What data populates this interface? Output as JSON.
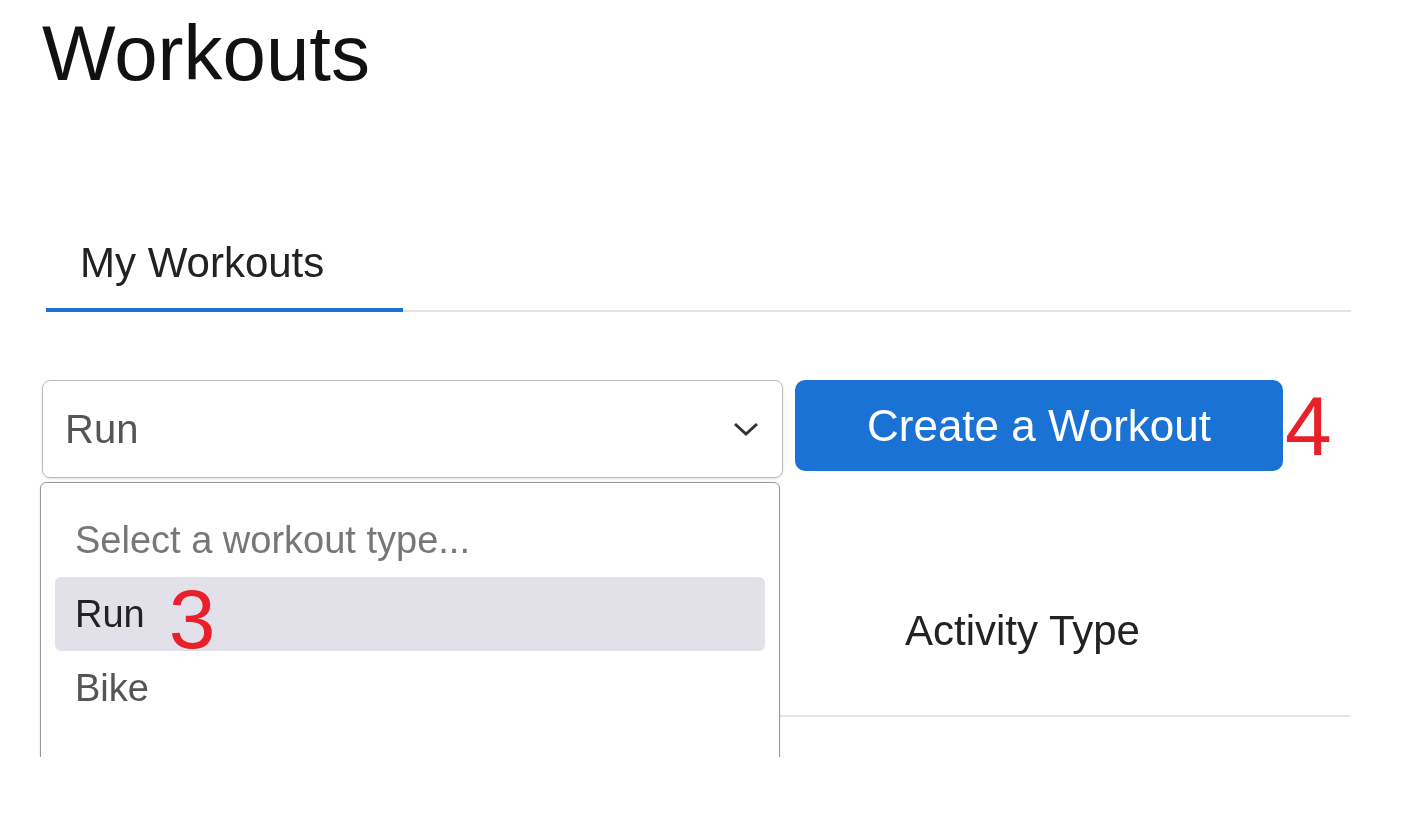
{
  "page_title": "Workouts",
  "tabs": [
    {
      "label": "My Workouts",
      "selected": true
    }
  ],
  "workout_type_select": {
    "value": "Run",
    "expanded": true,
    "options": [
      {
        "label": "Select a workout type...",
        "kind": "placeholder",
        "selected": false
      },
      {
        "label": "Run",
        "kind": "option",
        "selected": true,
        "annotation": "3"
      },
      {
        "label": "Bike",
        "kind": "option",
        "selected": false
      }
    ]
  },
  "create_button": {
    "label": "Create a Workout",
    "annotation": "4"
  },
  "table": {
    "columns": [
      "Activity Type"
    ]
  }
}
